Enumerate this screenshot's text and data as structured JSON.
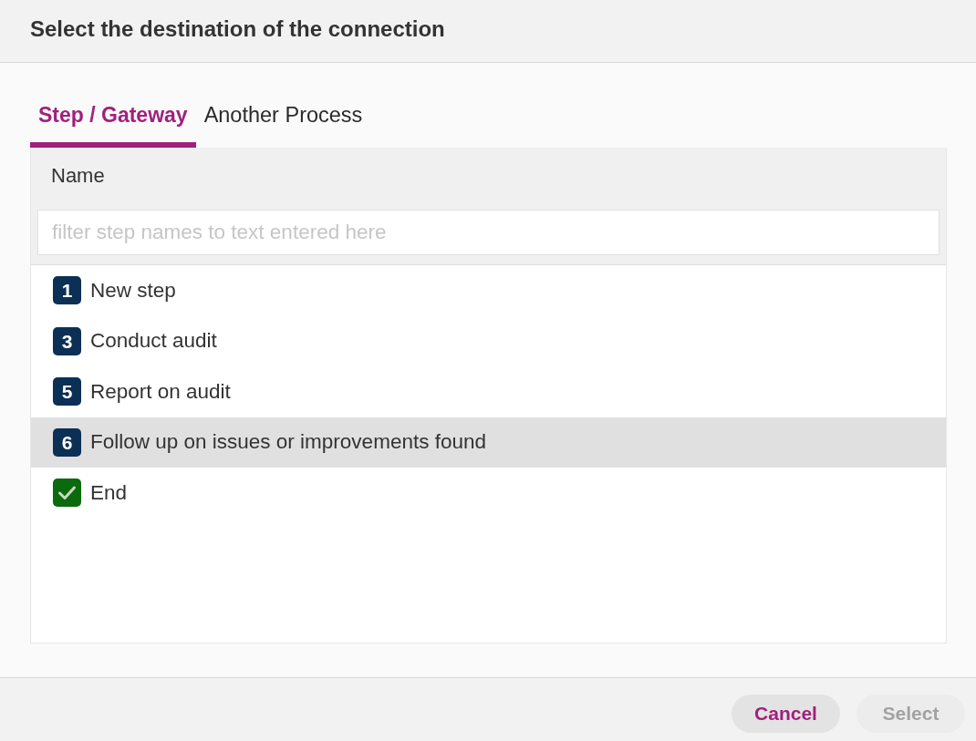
{
  "dialog": {
    "title": "Select the destination of the connection"
  },
  "tabs": [
    {
      "label": "Step / Gateway",
      "selected": true
    },
    {
      "label": "Another Process",
      "selected": false
    }
  ],
  "table": {
    "columns": [
      "Name"
    ],
    "filter": {
      "placeholder": "filter step names to text entered here"
    },
    "rows": [
      {
        "kind": "step",
        "number": "1",
        "name": "New step",
        "selected": false
      },
      {
        "kind": "step",
        "number": "3",
        "name": "Conduct audit",
        "selected": false
      },
      {
        "kind": "step",
        "number": "5",
        "name": "Report on audit",
        "selected": false
      },
      {
        "kind": "step",
        "number": "6",
        "name": "Follow up on issues or improvements found",
        "selected": true
      },
      {
        "kind": "end",
        "name": "End",
        "selected": false
      }
    ]
  },
  "buttons": [
    {
      "label": "Cancel",
      "disabled": false
    },
    {
      "label": "Select",
      "disabled": true
    }
  ]
}
